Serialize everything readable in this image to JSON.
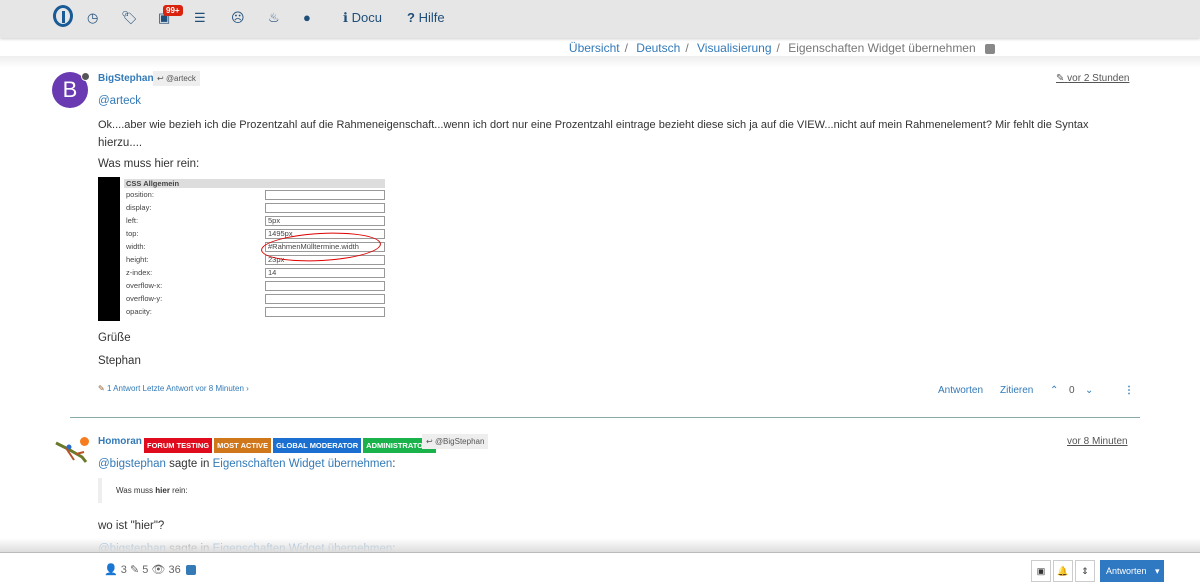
{
  "nav": {
    "badge": "99+",
    "docu": "Docu",
    "hilfe": "Hilfe"
  },
  "breadcrumb": [
    "Übersicht",
    "Deutsch",
    "Visualisierung",
    "Eigenschaften Widget übernehmen"
  ],
  "post1": {
    "avatar_letter": "B",
    "avatar_color": "#6a3ab2",
    "user": "BigStephan",
    "reply_to": "@arteck",
    "time": "vor 2 Stunden",
    "mention": "@arteck",
    "line1": "Ok....aber wie bezieh ich die Prozentzahl auf die Rahmeneigenschaft...wenn ich dort nur eine Prozentzahl eintrage bezieht diese sich ja auf die VIEW...nicht auf mein Rahmenelement? Mir fehlt die Syntax",
    "line2": "hierzu....",
    "question": "Was muss hier rein:",
    "screenshot": {
      "header": "CSS Allgemein",
      "rows": [
        [
          "position:",
          ""
        ],
        [
          "display:",
          ""
        ],
        [
          "left:",
          "5px"
        ],
        [
          "top:",
          "1495px"
        ],
        [
          "width:",
          "#RahmenMülltermine.width"
        ],
        [
          "height:",
          "23px"
        ],
        [
          "z-index:",
          "14"
        ],
        [
          "overflow-x:",
          ""
        ],
        [
          "overflow-y:",
          ""
        ],
        [
          "opacity:",
          ""
        ]
      ]
    },
    "greeting": "Grüße",
    "signature": "Stephan",
    "replies_meta": "1 Antwort Letzte Antwort vor 8 Minuten",
    "actions": {
      "reply": "Antworten",
      "quote": "Zitieren",
      "votes": "0"
    }
  },
  "post2": {
    "user": "Homoran",
    "tags": [
      {
        "label": "FORUM TESTING",
        "color": "#e00b1c"
      },
      {
        "label": "MOST ACTIVE",
        "color": "#d0761b"
      },
      {
        "label": "GLOBAL MODERATOR",
        "color": "#1a6fd1"
      },
      {
        "label": "ADMINISTRATORS",
        "color": "#19b24b"
      }
    ],
    "reply_to": "@BigStephan",
    "time": "vor 8 Minuten",
    "quote_user": "@bigstephan",
    "quote_said": "sagte in",
    "quote_topic": "Eigenschaften Widget übernehmen",
    "quote_pre": "Was muss ",
    "quote_bold": "hier",
    "quote_post": " rein:",
    "text": "wo ist \"hier\"?"
  },
  "footer": {
    "posters": "3",
    "posts": "5",
    "views": "36",
    "reply_button": "Antworten"
  }
}
